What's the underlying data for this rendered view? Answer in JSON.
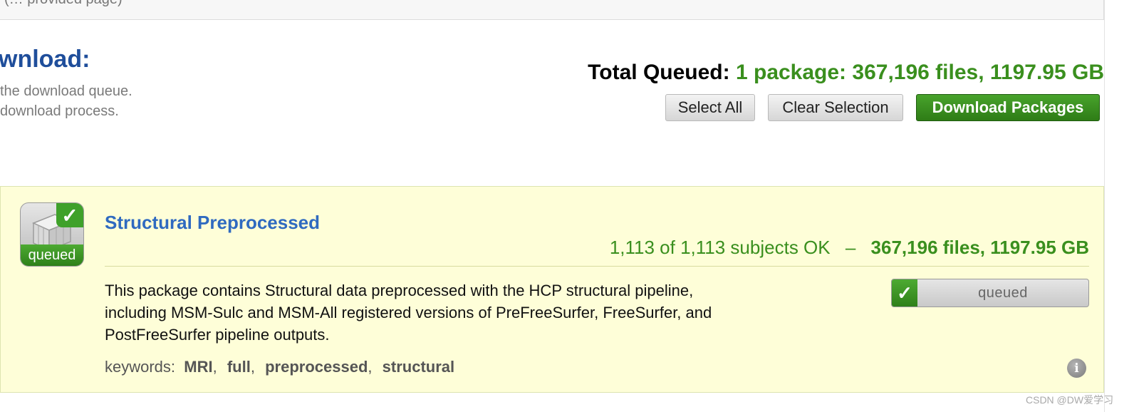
{
  "top_strip": {
    "cut_text": "(… provided page)"
  },
  "header": {
    "heading": "wnload:",
    "intro_line_1": "the download queue.",
    "intro_line_2": "download process."
  },
  "totals": {
    "label": "Total Queued:",
    "value": "1 package: 367,196 files, 1197.95 GB"
  },
  "buttons": {
    "select_all": "Select All",
    "clear_selection": "Clear Selection",
    "download_packages": "Download Packages"
  },
  "package": {
    "icon_badge": "queued",
    "icon_check": "✓",
    "title": "Structural Preprocessed",
    "subjects_status": "1,113 of 1,113 subjects OK",
    "separator": "–",
    "files_size": "367,196 files, 1197.95 GB",
    "description_lines": [
      "This package contains Structural data preprocessed with the HCP structural pipeline,",
      "including MSM-Sulc and MSM-All registered versions of PreFreeSurfer, FreeSurfer, and",
      "PostFreeSurfer pipeline outputs."
    ],
    "keywords_label": "keywords:",
    "keywords": [
      "MRI",
      "full",
      "preprocessed",
      "structural"
    ],
    "toggle_check": "✓",
    "toggle_label": "queued",
    "info_glyph": "i"
  },
  "watermark": "CSDN @DW爱学习",
  "colors": {
    "heading_blue": "#1f4e9b",
    "title_blue": "#2f6ac0",
    "accent_green": "#3a8f1e",
    "panel_bg": "#fefed8"
  },
  "icons": {
    "package": "cube-queued-icon",
    "toggle": "checkmark-icon",
    "info": "info-icon"
  }
}
